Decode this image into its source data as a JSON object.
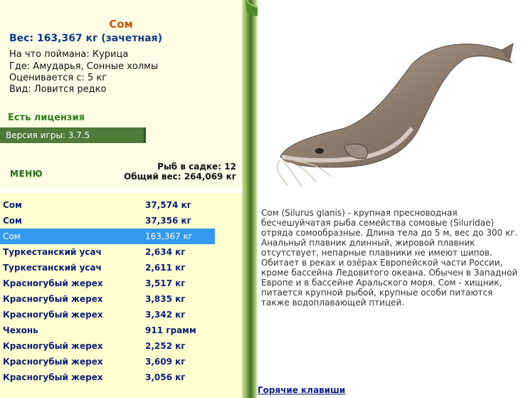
{
  "info": {
    "title": "Сом",
    "weight_line": "Вес: 163,367 кг (зачетная)",
    "bait": "На что поймана: Курица",
    "location": "Где: Амударья, Сонные холмы",
    "value": "Оценивается с: 5 кг",
    "kind": "Вид: Ловится редко",
    "license": "Есть лицензия",
    "version": "Версия игры: 3.7.5",
    "menu_label": "МЕНЮ",
    "cage_count": "Рыб в садке: 12",
    "total_weight": "Общий вес: 264,069 кг"
  },
  "catch_list": [
    {
      "name": "Сом",
      "weight": "37,574 кг"
    },
    {
      "name": "Сом",
      "weight": "37,356 кг"
    },
    {
      "name": "Сом",
      "weight": "163,367 кг",
      "selected": true
    },
    {
      "name": "Туркестанский усач",
      "weight": "2,634 кг"
    },
    {
      "name": "Туркестанский усач",
      "weight": "2,611 кг"
    },
    {
      "name": "Красногубый жерех",
      "weight": "3,517 кг"
    },
    {
      "name": "Красногубый жерех",
      "weight": "3,835 кг"
    },
    {
      "name": "Красногубый жерех",
      "weight": "3,342 кг"
    },
    {
      "name": "Чехонь",
      "weight": "911 грамм"
    },
    {
      "name": "Красногубый жерех",
      "weight": "2,252 кг"
    },
    {
      "name": "Красногубый жерех",
      "weight": "3,609 кг"
    },
    {
      "name": "Красногубый жерех",
      "weight": "3,056 кг"
    }
  ],
  "description": "Сом (Silurus glanis) - крупная пресноводная бесчешуйчатая рыба семейства сомовые (Siluridae) отряда сомообразные. Длина тела до 5 м, вес до 300 кг. Анальный плавник длинный, жировой плавник отсутствует, непарные плавники не имеют шипов. Обитает в реках и озёрах Европейской части России, кроме бассейна Ледовитого океана. Обычен в Западной Европе и в бассейне Аральского моря. Сом - хищник, питается крупной рыбой, крупные особи питаются также водоплавающей птицей.",
  "hotkeys_link": "Горячие клавиши",
  "colors": {
    "selected_row": "#3399ee",
    "list_text": "#0d1e7a",
    "title": "#cc5500",
    "license": "#2f7d1e",
    "version_bar": "#4f7a3a"
  }
}
